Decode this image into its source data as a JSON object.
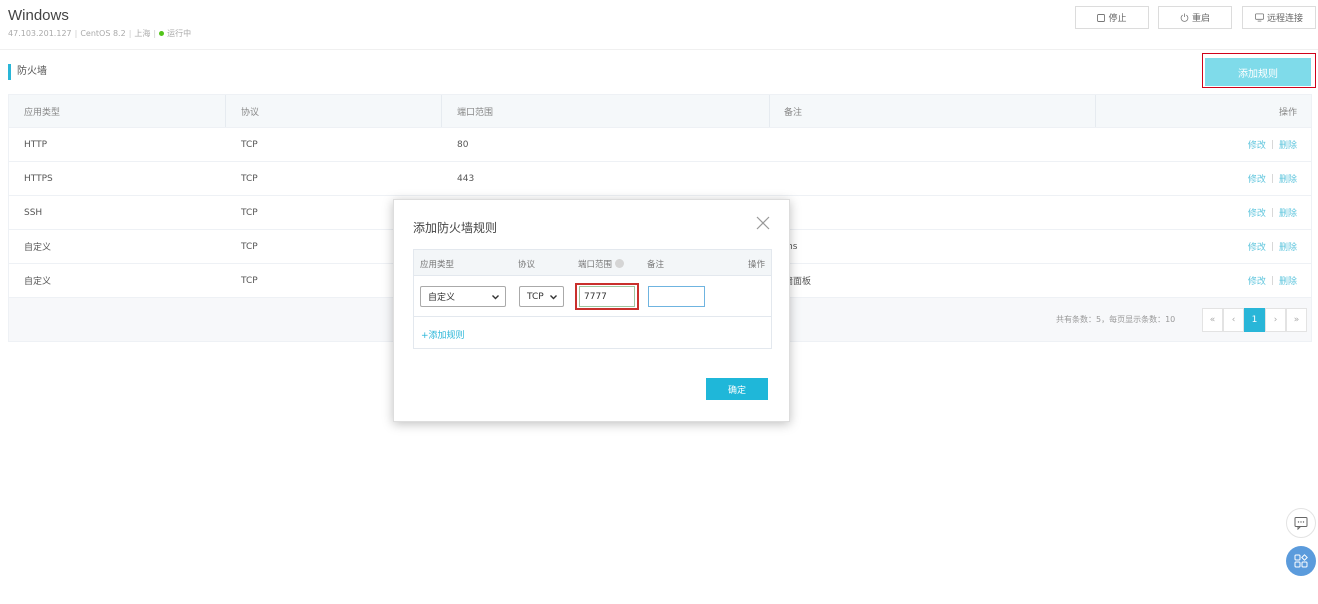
{
  "header": {
    "title": "Windows",
    "ip": "47.103.201.127",
    "os": "CentOS 8.2",
    "region": "上海",
    "status": "运行中",
    "status_color": "#52c41a",
    "buttons": {
      "stop": "停止",
      "restart": "重启",
      "remote": "远程连接"
    }
  },
  "section": {
    "title": "防火墙",
    "add_rule": "添加规则"
  },
  "table": {
    "headers": [
      "应用类型",
      "协议",
      "端口范围",
      "备注",
      "操作"
    ],
    "rows": [
      {
        "type": "HTTP",
        "protocol": "TCP",
        "port": "80",
        "note": ""
      },
      {
        "type": "HTTPS",
        "protocol": "TCP",
        "port": "443",
        "note": ""
      },
      {
        "type": "SSH",
        "protocol": "TCP",
        "port": "",
        "note": ""
      },
      {
        "type": "自定义",
        "protocol": "TCP",
        "port": "",
        "note": "ms"
      },
      {
        "type": "自定义",
        "protocol": "TCP",
        "port": "",
        "note": "墙面板"
      }
    ],
    "edit_label": "修改",
    "delete_label": "删除"
  },
  "pagination": {
    "info": "共有条数：5，每页显示条数：10",
    "first": "«",
    "prev": "‹",
    "current": "1",
    "next": "›",
    "last": "»"
  },
  "modal": {
    "title": "添加防火墙规则",
    "headers": {
      "type": "应用类型",
      "protocol": "协议",
      "port": "端口范围",
      "note": "备注",
      "action": "操作"
    },
    "type_value": "自定义",
    "protocol_value": "TCP",
    "port_value": "7777",
    "note_value": "",
    "add_rule_link": "+添加规则",
    "confirm": "确定"
  },
  "colors": {
    "accent": "#29b6d8",
    "highlight_outline": "#d0021b"
  }
}
